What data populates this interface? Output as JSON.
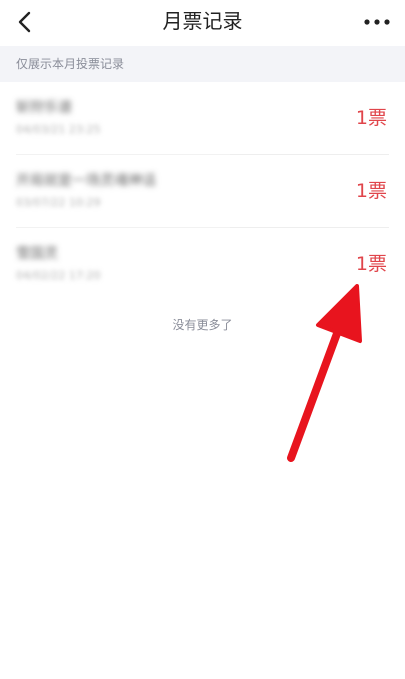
{
  "header": {
    "title": "月票记录"
  },
  "notice": "仅展示本月投票记录",
  "records": [
    {
      "title": "斩狩乐谱",
      "time": "04/03/21 23:25",
      "votes": "1票"
    },
    {
      "title": "开局就是一场灵魂神话",
      "time": "03/07/22 10:29",
      "votes": "1票"
    },
    {
      "title": "雪国灵",
      "time": "04/02/22 17:20",
      "votes": "1票"
    }
  ],
  "list_end": "没有更多了",
  "colors": {
    "accent": "#e0454b",
    "annotation_arrow": "#e8141e",
    "notice_bg": "#f3f4f8"
  },
  "icons": {
    "back": "chevron-left-icon",
    "more": "more-dots-icon"
  }
}
